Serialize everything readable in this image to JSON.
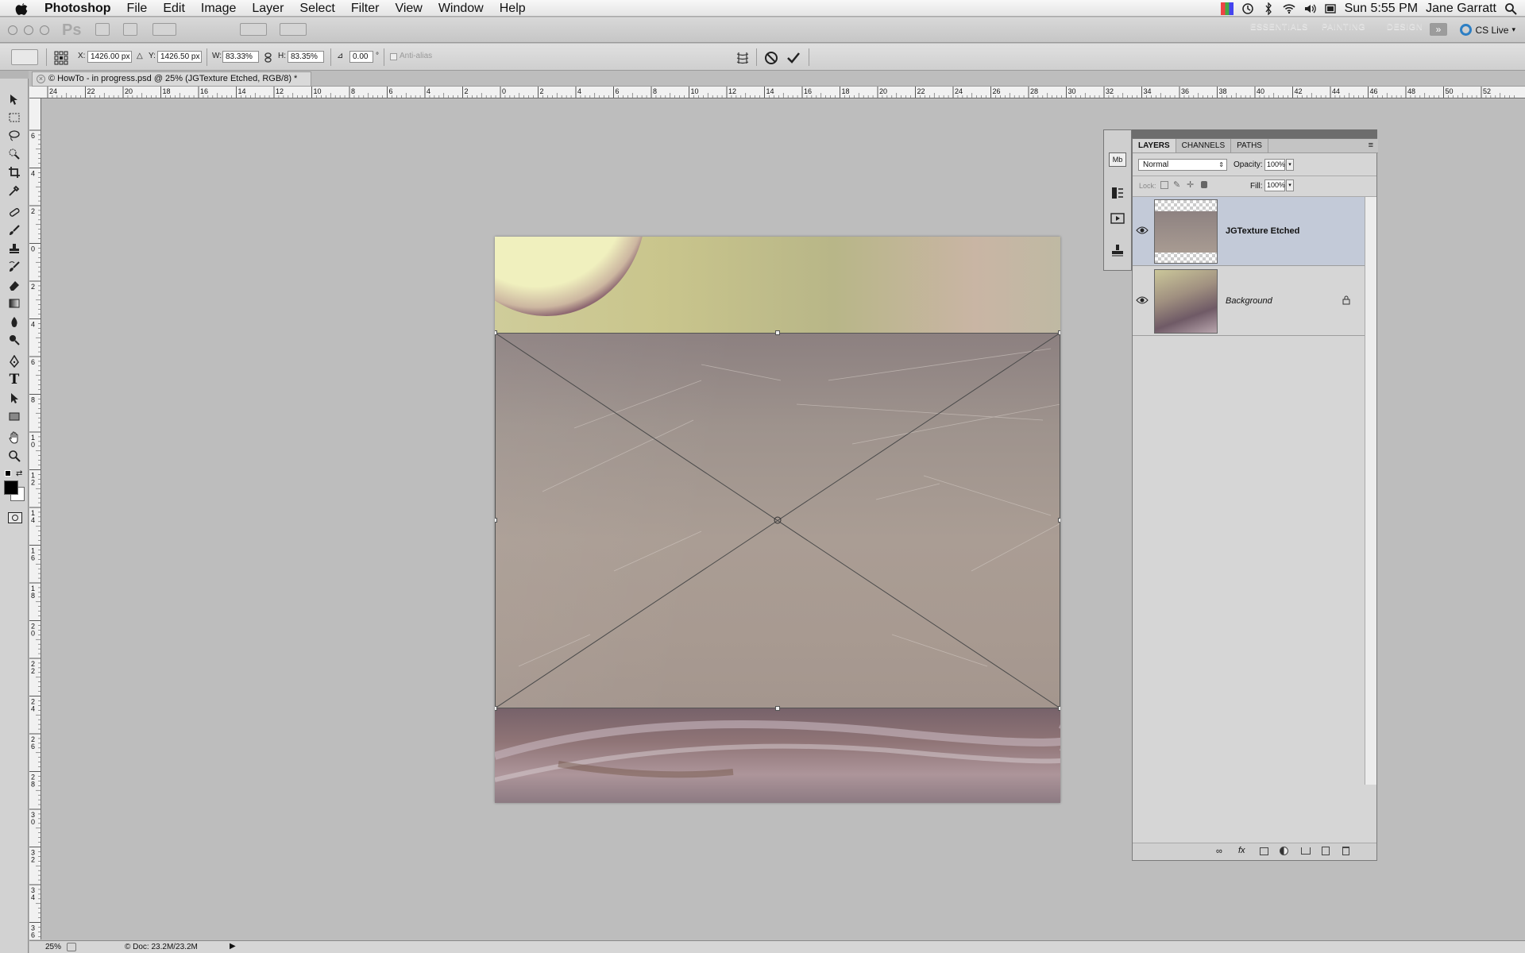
{
  "menubar": {
    "app_name": "Photoshop",
    "items": [
      "File",
      "Edit",
      "Image",
      "Layer",
      "Select",
      "Filter",
      "View",
      "Window",
      "Help"
    ],
    "clock": "Sun 5:55 PM",
    "user": "Jane Garratt"
  },
  "appbar": {
    "logo": "Ps",
    "workspaces": [
      "ESSENTIALS",
      "PAINTING",
      "DESIGN"
    ],
    "cs_live": "CS Live"
  },
  "options": {
    "x_label": "X:",
    "x_value": "1426.00 px",
    "y_label": "Y:",
    "y_value": "1426.50 px",
    "w_label": "W:",
    "w_value": "83.33%",
    "h_label": "H:",
    "h_value": "83.35%",
    "rot_value": "0.00",
    "rot_unit": "°",
    "antialias": "Anti-alias"
  },
  "document": {
    "tab_title": "© HowTo - in progress.psd @ 25% (JGTexture Etched, RGB/8) *"
  },
  "ruler": {
    "h_labels": [
      "24",
      "22",
      "20",
      "18",
      "16",
      "14",
      "12",
      "10",
      "8",
      "6",
      "4",
      "2",
      "0",
      "2",
      "4",
      "6",
      "8",
      "10",
      "12",
      "14",
      "16",
      "18",
      "20",
      "22",
      "24",
      "26",
      "28",
      "30",
      "32",
      "34",
      "36",
      "38",
      "40",
      "42",
      "44",
      "46",
      "48",
      "50",
      "52"
    ],
    "v_labels": [
      "6",
      "4",
      "2",
      "0",
      "2",
      "4",
      "6",
      "8",
      "10",
      "12",
      "14",
      "16",
      "18",
      "20",
      "22",
      "24",
      "26",
      "28",
      "30",
      "32",
      "34",
      "36"
    ]
  },
  "layers_panel": {
    "tabs": [
      "LAYERS",
      "CHANNELS",
      "PATHS"
    ],
    "blend_mode": "Normal",
    "opacity_label": "Opacity:",
    "opacity_value": "100%",
    "lock_label": "Lock:",
    "fill_label": "Fill:",
    "fill_value": "100%",
    "layers": [
      {
        "name": "JGTexture Etched",
        "selected": true
      },
      {
        "name": "Background",
        "locked": true
      }
    ]
  },
  "status": {
    "zoom": "25%",
    "doc": "© Doc: 23.2M/23.2M"
  }
}
